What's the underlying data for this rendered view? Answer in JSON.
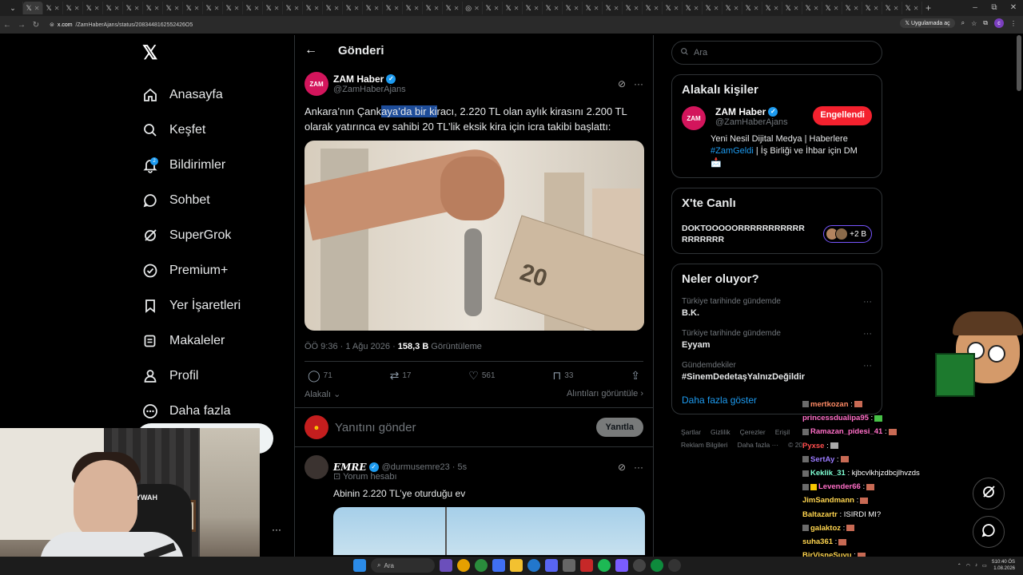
{
  "browser": {
    "url_host": "x.com",
    "url_path": "/ZamHaberAjans/status/2083448162552426O5",
    "app_label": "Uygulamada aç",
    "profile_initial": "c"
  },
  "nav": {
    "items": [
      {
        "label": "Anasayfa",
        "icon": "home-icon"
      },
      {
        "label": "Keşfet",
        "icon": "search-icon"
      },
      {
        "label": "Bildirimler",
        "icon": "bell-icon",
        "badge": "2"
      },
      {
        "label": "Sohbet",
        "icon": "chat-icon"
      },
      {
        "label": "SuperGrok",
        "icon": "grok-icon"
      },
      {
        "label": "Premium+",
        "icon": "verified-icon"
      },
      {
        "label": "Yer İşaretleri",
        "icon": "bookmark-icon"
      },
      {
        "label": "Makaleler",
        "icon": "article-icon"
      },
      {
        "label": "Profil",
        "icon": "person-icon"
      },
      {
        "label": "Daha fazla",
        "icon": "more-circle-icon"
      }
    ]
  },
  "main": {
    "title": "Gönderi",
    "tweet": {
      "avatar_text": "ZAM",
      "name": "ZAM Haber",
      "handle": "@ZamHaberAjans",
      "text_pre": "Ankara’nın Çank",
      "text_hl": "aya’da bir ki",
      "text_post": "racı, 2.220 TL olan aylık kirasını 2.200 TL olarak yatırınca ev sahibi 20 TL’lik eksik kira için icra takibi başlattı:",
      "image_note": "20",
      "time": "ÖÖ 9:36 · 1 Ağu 2026 ·",
      "views": "158,3 B",
      "views_label": "Görüntüleme",
      "stats": {
        "replies": "71",
        "reposts": "17",
        "likes": "561",
        "bookmarks": "33"
      },
      "related": "Alakalı",
      "quotes": "Alıntıları görüntüle"
    },
    "reply_box": {
      "placeholder": "Yanıtını gönder",
      "button": "Yanıtla"
    },
    "reply": {
      "name": "𝑬𝑴𝑹𝑬",
      "handle": "@durmusemre23 · 5s",
      "sub": "Yorum hesabı",
      "text": "Abinin 2.220 TL’ye oturduğu ev"
    }
  },
  "right": {
    "search_placeholder": "Ara",
    "people": {
      "title": "Alakalı kişiler",
      "name": "ZAM Haber",
      "handle": "@ZamHaberAjans",
      "button": "Engellendi",
      "bio_1": "Yeni Nesil Dijital Medya | Haberlere",
      "bio_tag": "#ZamGeldi",
      "bio_2": "| İş Birliği ve İhbar için DM",
      "bio_3": "📩"
    },
    "live": {
      "title": "X'te Canlı",
      "text": "DOKTOOOOORRRRRRRRRRRRRRRRRR",
      "count": "+2 B"
    },
    "trends": {
      "title": "Neler oluyor?",
      "items": [
        {
          "context": "Türkiye tarihinde gündemde",
          "name": "B.K."
        },
        {
          "context": "Türkiye tarihinde gündemde",
          "name": "Eyyam"
        },
        {
          "context": "Gündemdekiler",
          "name": "#SinemDedetaşYalnızDeğildir"
        }
      ],
      "show_more": "Daha fazla göster"
    },
    "footer": {
      "links": [
        "Şartlar",
        "Gizlilik",
        "Çerezler",
        "Erişil"
      ],
      "links2": [
        "Reklam Bilgileri",
        "Daha fazla ···",
        "© 20"
      ]
    }
  },
  "chat": [
    {
      "user": "mertkozan",
      "msg": ":",
      "color": "#ff8a65"
    },
    {
      "user": "princessdualipa95",
      "msg": ":",
      "color": "#ff6ec7"
    },
    {
      "user": "Ramazan_pidesi_41",
      "msg": ":",
      "color": "#ff6ec7"
    },
    {
      "user": "Pyxse",
      "msg": ":",
      "color": "#ff4d4d"
    },
    {
      "user": "SertAy",
      "msg": ":",
      "color": "#9b7bff"
    },
    {
      "user": "Keklik_31",
      "msg": ": kjbcvlkhjzdbcjlhvzds",
      "color": "#7fffd4"
    },
    {
      "user": "Levender66",
      "msg": ":",
      "color": "#ff6ec7"
    },
    {
      "user": "JimSandmann",
      "msg": ":",
      "color": "#ffd54f"
    },
    {
      "user": "Baltazartr",
      "msg": ": ISIRDI MI?",
      "color": "#ffd54f"
    },
    {
      "user": "galaktoz",
      "msg": ":",
      "color": "#ffd54f"
    },
    {
      "user": "suha361",
      "msg": ":",
      "color": "#ffd54f"
    },
    {
      "user": "BirVisneSuyu",
      "msg": ":",
      "color": "#ffd54f"
    }
  ],
  "webcam": {
    "chair_text": "YWAH"
  },
  "taskbar": {
    "search": "Ara",
    "time": "S10:40 ÖS",
    "date": "1.08.2026"
  }
}
